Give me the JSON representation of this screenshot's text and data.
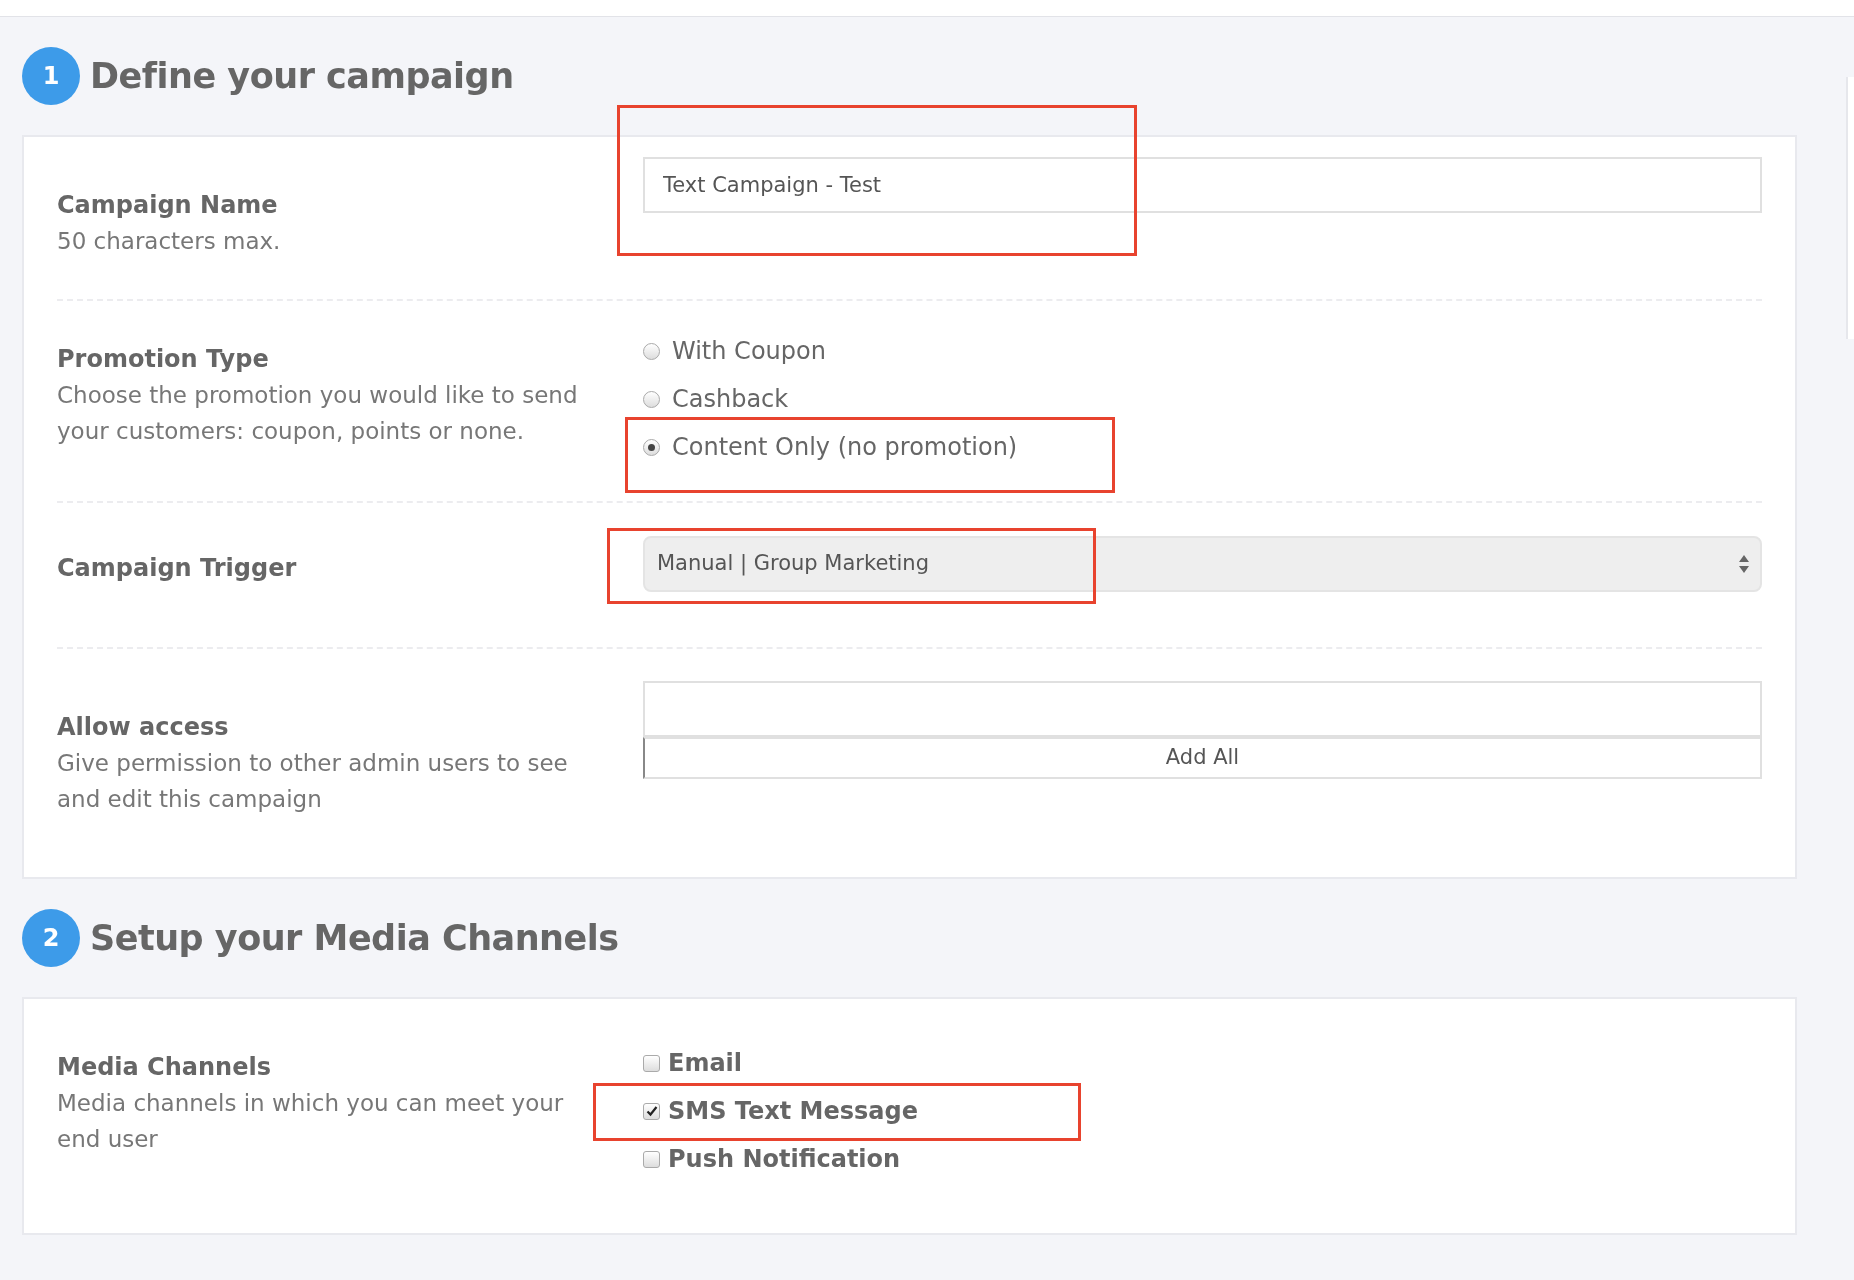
{
  "sections": [
    {
      "number": "1",
      "title": "Define your campaign",
      "rows": [
        {
          "kind": "text",
          "label": "Campaign Name",
          "help": "50 characters max.",
          "value": "Text Campaign - Test",
          "highlighted": true
        },
        {
          "kind": "radio",
          "label": "Promotion Type",
          "help": "Choose the promotion you would like to send your customers: coupon, points or none.",
          "options": [
            {
              "label": "With Coupon",
              "selected": false,
              "highlighted": false
            },
            {
              "label": "Cashback",
              "selected": false,
              "highlighted": false
            },
            {
              "label": "Content Only (no promotion)",
              "selected": true,
              "highlighted": true
            }
          ]
        },
        {
          "kind": "select",
          "label": "Campaign Trigger",
          "value": "Manual | Group Marketing",
          "highlighted": true
        },
        {
          "kind": "access",
          "label": "Allow access",
          "help": "Give permission to other admin users to see and edit this campaign",
          "button": "Add All"
        }
      ]
    },
    {
      "number": "2",
      "title": "Setup your Media Channels",
      "rows": [
        {
          "kind": "checkbox",
          "label": "Media Channels",
          "help": "Media channels in which you can meet your end user",
          "options": [
            {
              "label": "Email",
              "checked": false,
              "highlighted": false
            },
            {
              "label": "SMS Text Message",
              "checked": true,
              "highlighted": true
            },
            {
              "label": "Push Notification",
              "checked": false,
              "highlighted": false
            }
          ]
        }
      ]
    }
  ]
}
